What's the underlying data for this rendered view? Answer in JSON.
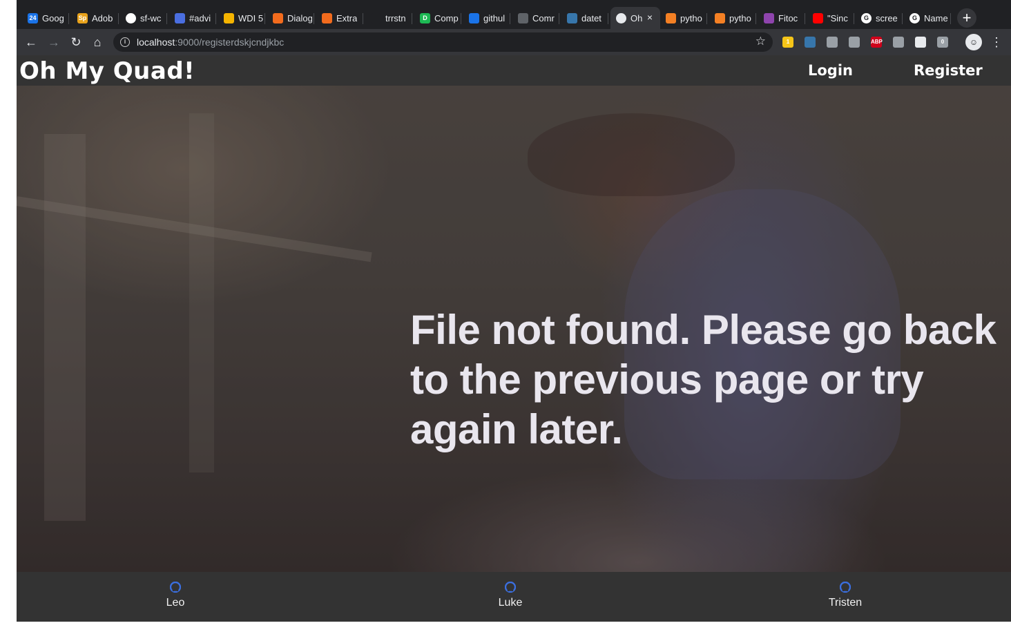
{
  "browser": {
    "tabs": [
      {
        "title": "Goog",
        "icon": "calendar-icon",
        "color": "#1a73e8",
        "glyph": "24"
      },
      {
        "title": "Adob",
        "icon": "adobe-spark-icon",
        "color": "#e8a21b",
        "glyph": "Sp"
      },
      {
        "title": "sf-wc",
        "icon": "github-icon",
        "color": "#ffffff",
        "glyph": ""
      },
      {
        "title": "#advi",
        "icon": "calendar-alert-icon",
        "color": "#4a6ee0",
        "glyph": ""
      },
      {
        "title": "WDI 5",
        "icon": "slides-icon",
        "color": "#f5b400",
        "glyph": ""
      },
      {
        "title": "Dialog",
        "icon": "hexagon-icon",
        "color": "#f26b1d",
        "glyph": ""
      },
      {
        "title": "Extra",
        "icon": "hexagon-icon",
        "color": "#f26b1d",
        "glyph": ""
      },
      {
        "title": "trrstn",
        "icon": "circle-icon",
        "color": "#202124",
        "glyph": ""
      },
      {
        "title": "Comp",
        "icon": "d-icon",
        "color": "#1db954",
        "glyph": "D"
      },
      {
        "title": "githul",
        "icon": "flag-icon",
        "color": "#1a73e8",
        "glyph": ""
      },
      {
        "title": "Comr",
        "icon": "qr-icon",
        "color": "#5f6368",
        "glyph": ""
      },
      {
        "title": "datet",
        "icon": "python-icon",
        "color": "#3776ab",
        "glyph": ""
      },
      {
        "title": "Oh",
        "icon": "page-icon",
        "color": "#e8eaed",
        "glyph": "",
        "active": true
      },
      {
        "title": "pytho",
        "icon": "stackoverflow-icon",
        "color": "#f48024",
        "glyph": ""
      },
      {
        "title": "pytho",
        "icon": "stackoverflow-icon",
        "color": "#f48024",
        "glyph": ""
      },
      {
        "title": "Fitoc",
        "icon": "fitocracy-icon",
        "color": "#8e44ad",
        "glyph": ""
      },
      {
        "title": "\"Sinc",
        "icon": "youtube-icon",
        "color": "#ff0000",
        "glyph": ""
      },
      {
        "title": "scree",
        "icon": "google-icon",
        "color": "#ffffff",
        "glyph": "G"
      },
      {
        "title": "Name",
        "icon": "google-icon",
        "color": "#ffffff",
        "glyph": "G"
      }
    ],
    "new_tab": "+",
    "address": {
      "host": "localhost",
      "path": ":9000/registerdskjcndjkbc"
    },
    "extensions": [
      {
        "name": "sticky-notes-ext-icon",
        "color": "#f5c518",
        "badge": "1"
      },
      {
        "name": "python-ext-icon",
        "color": "#3776ab",
        "badge": ""
      },
      {
        "name": "notion-ext-icon",
        "color": "#9aa0a6",
        "badge": ""
      },
      {
        "name": "shield-ext-icon",
        "color": "#9aa0a6",
        "badge": ""
      },
      {
        "name": "adblock-ext-icon",
        "color": "#d0021b",
        "badge": "ABP"
      },
      {
        "name": "bottle-ext-icon",
        "color": "#9aa0a6",
        "badge": ""
      },
      {
        "name": "react-ext-icon",
        "color": "#e8eaed",
        "badge": ""
      },
      {
        "name": "zero-ext-icon",
        "color": "#9aa0a6",
        "badge": "0"
      }
    ]
  },
  "site": {
    "logo": "Oh My Quad!",
    "nav": {
      "login": "Login",
      "register": "Register"
    },
    "message": "File not found. Please go back to the previous page or try again later.",
    "credits": [
      "Leo",
      "Luke",
      "Tristen"
    ],
    "credit_icon": "github-icon",
    "credit_icon_color": "#3b6fe0"
  }
}
